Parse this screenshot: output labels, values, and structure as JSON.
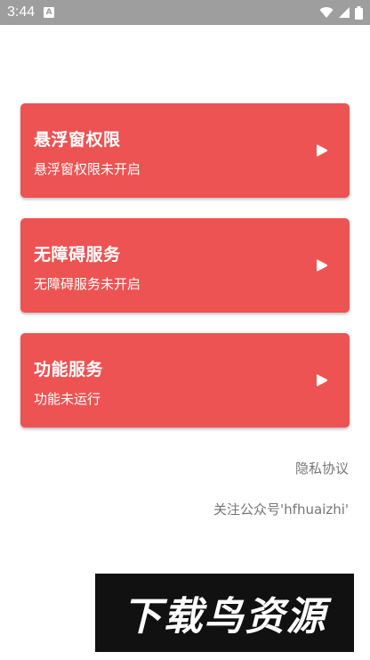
{
  "status_bar": {
    "time": "3:44",
    "notification_badge": "A",
    "icons": [
      "wifi-icon",
      "signal-icon",
      "battery-icon"
    ]
  },
  "cards": [
    {
      "title": "悬浮窗权限",
      "subtitle": "悬浮窗权限未开启"
    },
    {
      "title": "无障碍服务",
      "subtitle": "无障碍服务未开启"
    },
    {
      "title": "功能服务",
      "subtitle": "功能未运行"
    }
  ],
  "links": {
    "privacy": "隐私协议",
    "follow": "关注公众号'hfhuaizhi'"
  },
  "watermark": {
    "text": "下载鸟资源"
  },
  "colors": {
    "card_background": "#ed5352",
    "status_bar": "#9e9e9e",
    "secondary_text": "#757575"
  }
}
